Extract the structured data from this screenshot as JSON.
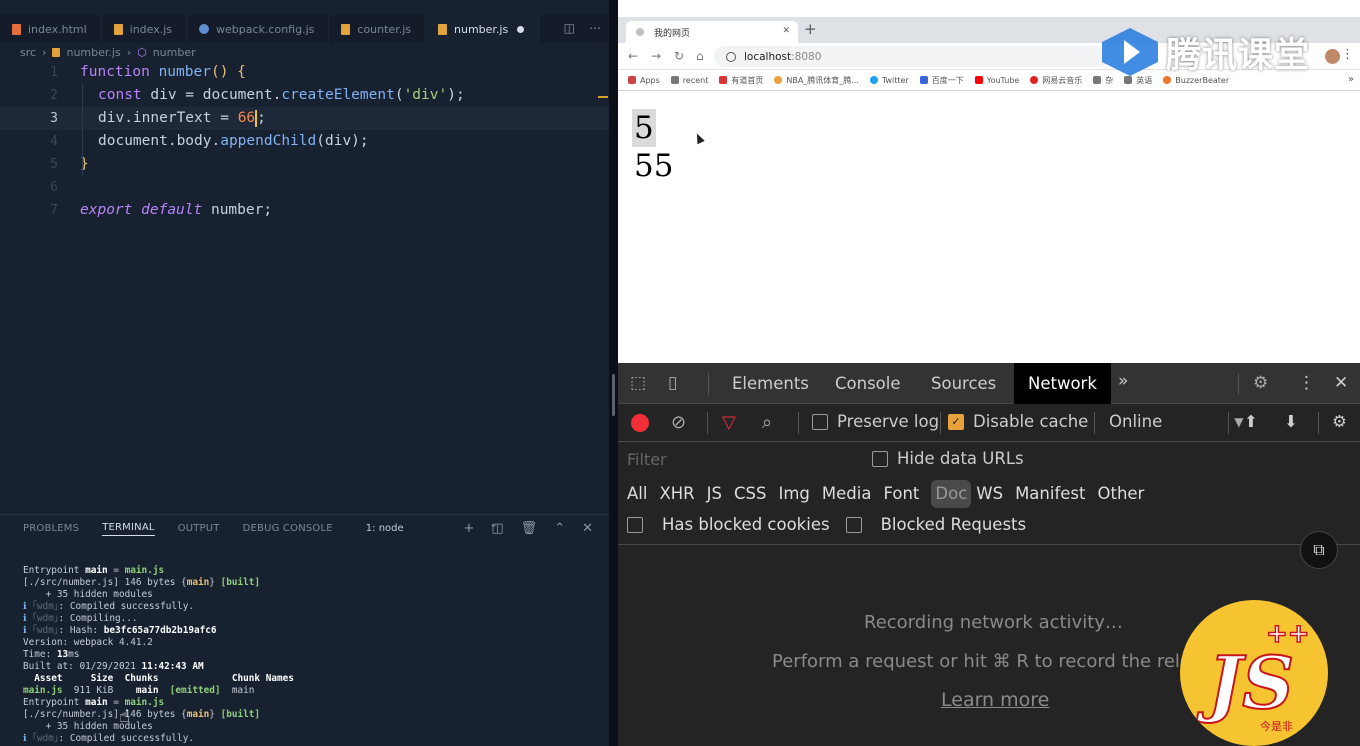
{
  "editor": {
    "tabs": [
      {
        "label": "index.html",
        "type": "html",
        "active": false
      },
      {
        "label": "index.js",
        "type": "js",
        "active": false
      },
      {
        "label": "webpack.config.js",
        "type": "wp",
        "active": false
      },
      {
        "label": "counter.js",
        "type": "js",
        "active": false
      },
      {
        "label": "number.js",
        "type": "js",
        "active": true,
        "unsaved": true
      }
    ],
    "breadcrumb": [
      "src",
      "number.js",
      "number"
    ],
    "lines": [
      "1",
      "2",
      "3",
      "4",
      "5",
      "6",
      "7"
    ],
    "current_line": 3,
    "code": {
      "l1_kw": "function",
      "l1_fn": "number",
      "l1_rest": "() {",
      "l2_kw": "const",
      "l2_a": " div = document.",
      "l2_fn": "createElement",
      "l2_p": "(",
      "l2_s": "'div'",
      "l2_e": ");",
      "l3_a": "div.innerText = ",
      "l3_n": "66",
      "l3_e": ";",
      "l4_a": "document.body.",
      "l4_fn": "appendChild",
      "l4_e": "(div);",
      "l5": "}",
      "l7_kw1": "export",
      "l7_kw2": "default",
      "l7_e": " number;"
    }
  },
  "terminal": {
    "tabs": [
      "PROBLEMS",
      "TERMINAL",
      "OUTPUT",
      "DEBUG CONSOLE"
    ],
    "active_tab": "TERMINAL",
    "selector": "1: node",
    "lines": {
      "t1a": "Entrypoint ",
      "t1b": "main",
      "t1c": " = ",
      "t1d": "main.js",
      "t2a": "[./src/number.js] 146 bytes {",
      "t2b": "main",
      "t2c": "} ",
      "t2d": "[built]",
      "t3": "    + 35 hidden modules",
      "t4a": "ℹ ",
      "t4b": "｢wdm｣",
      "t4c": ": Compiled successfully.",
      "t5a": "ℹ ",
      "t5b": "｢wdm｣",
      "t5c": ": Compiling...",
      "t6a": "ℹ ",
      "t6b": "｢wdm｣",
      "t6c": ": Hash: ",
      "t6d": "be3fc65a77db2b19afc6",
      "t7": "Version: webpack 4.41.2",
      "t8a": "Time: ",
      "t8b": "13",
      "t8c": "ms",
      "t9a": "Built at: 01/29/2021 ",
      "t9b": "11:42:43 AM",
      "t10": "  Asset     Size  Chunks             Chunk Names",
      "t11a": "main.js",
      "t11b": "  911 KiB    ",
      "t11c": "main",
      "t11d": "  ",
      "t11e": "[emitted]",
      "t11f": "  main",
      "t12a": "Entrypoint ",
      "t12b": "main",
      "t12c": " = ",
      "t12d": "main.js",
      "t13a": "[./src/number.js] 146 bytes {",
      "t13b": "main",
      "t13c": "} ",
      "t13d": "[built]",
      "t14": "    + 35 hidden modules",
      "t15a": "ℹ ",
      "t15b": "｢wdm｣",
      "t15c": ": Compiled successfully."
    }
  },
  "browser": {
    "tab_title": "我的网页",
    "url_host": "localhost",
    "url_port": ":8080",
    "bookmarks": [
      "Apps",
      "recent",
      "有道首页",
      "NBA_腾讯体育_腾...",
      "Twitter",
      "百度一下",
      "YouTube",
      "网易云音乐",
      "杂",
      "英语",
      "BuzzerBeater"
    ],
    "output": [
      "5",
      "55"
    ],
    "watermark": "腾讯课堂"
  },
  "devtools": {
    "tabs": [
      "Elements",
      "Console",
      "Sources",
      "Network"
    ],
    "active_tab": "Network",
    "preserve_log": "Preserve log",
    "disable_cache": "Disable cache",
    "throttle": "Online",
    "filter_placeholder": "Filter",
    "hide_data_urls": "Hide data URLs",
    "types": [
      "All",
      "XHR",
      "JS",
      "CSS",
      "Img",
      "Media",
      "Font",
      "Doc",
      "WS",
      "Manifest",
      "Other"
    ],
    "selected_type": "Doc",
    "has_blocked_cookies": "Has blocked cookies",
    "blocked_requests": "Blocked Requests",
    "recording": "Recording network activity…",
    "perform": "Perform a request or hit ⌘ R to record the relo",
    "learn_more": "Learn more"
  },
  "logo_text": "JS",
  "logo_sup": "++",
  "logo_sig": "今是非"
}
